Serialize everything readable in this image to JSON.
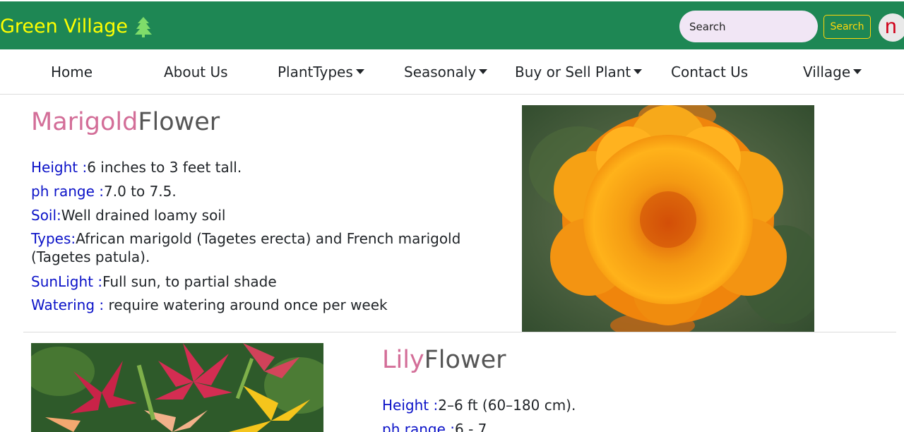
{
  "header": {
    "brand": "Green Village",
    "search_placeholder": "Search",
    "search_button": "Search",
    "avatar_letter": "n"
  },
  "nav": {
    "items": [
      {
        "label": "Home"
      },
      {
        "label": "About Us"
      },
      {
        "label": "PlantTypes"
      },
      {
        "label": "Seasonaly"
      },
      {
        "label": "Buy or Sell Plant"
      },
      {
        "label": "Contact Us"
      },
      {
        "label": "Village"
      }
    ]
  },
  "plants": [
    {
      "name": "Marigold",
      "suffix": "Flower",
      "props": [
        {
          "key": "Height :",
          "value": "6 inches to 3 feet tall."
        },
        {
          "key": "ph range :",
          "value": "7.0 to 7.5."
        },
        {
          "key": "Soil:",
          "value": "Well drained loamy soil"
        },
        {
          "key": "Types:",
          "value": "African marigold (Tagetes erecta) and French marigold (Tagetes patula)."
        },
        {
          "key": "SunLight :",
          "value": "Full sun, to partial shade"
        },
        {
          "key": "Watering :",
          "value": " require watering around once per week"
        }
      ]
    },
    {
      "name": "Lily",
      "suffix": "Flower",
      "props": [
        {
          "key": "Height :",
          "value": "2–6 ft (60–180 cm)."
        },
        {
          "key": "ph range :",
          "value": "6 - 7"
        }
      ]
    }
  ]
}
